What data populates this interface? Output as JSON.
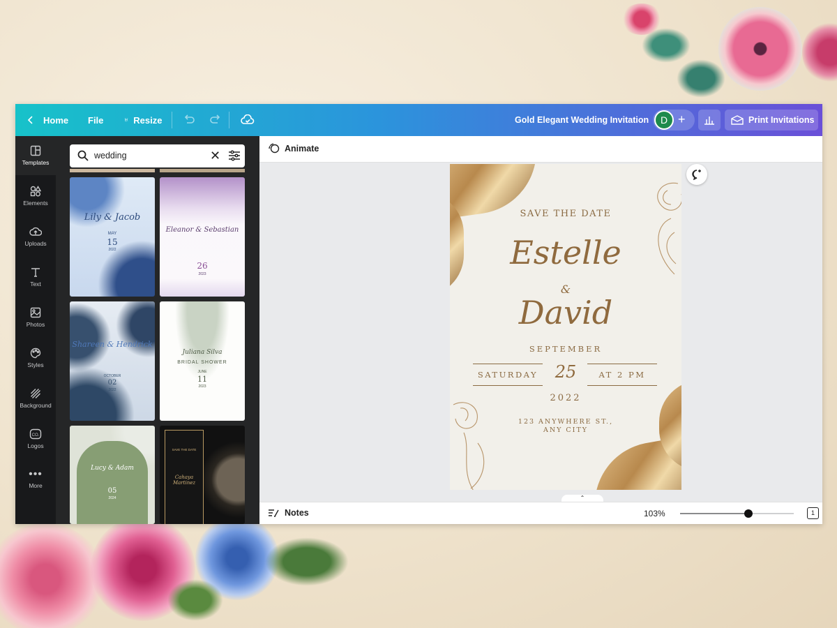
{
  "topbar": {
    "home": "Home",
    "file": "File",
    "resize": "Resize",
    "doc_title": "Gold Elegant Wedding Invitation",
    "avatar": "D",
    "print": "Print Invitations"
  },
  "rail": [
    {
      "label": "Templates",
      "icon": "template-icon"
    },
    {
      "label": "Elements",
      "icon": "shapes-icon"
    },
    {
      "label": "Uploads",
      "icon": "cloud-upload-icon"
    },
    {
      "label": "Text",
      "icon": "text-icon"
    },
    {
      "label": "Photos",
      "icon": "image-icon"
    },
    {
      "label": "Styles",
      "icon": "palette-icon"
    },
    {
      "label": "Background",
      "icon": "background-icon"
    },
    {
      "label": "Logos",
      "icon": "logo-icon"
    },
    {
      "label": "More",
      "icon": "more-icon"
    }
  ],
  "search": {
    "value": "wedding"
  },
  "templates": [
    {
      "title": "Lily & Jacob",
      "month": "MAY",
      "day": "15",
      "year": "2022",
      "theme": "blue watercolor"
    },
    {
      "title": "Eleanor & Sebastian",
      "day": "26",
      "year": "2023",
      "theme": "lavender wisteria"
    },
    {
      "title": "Shareen & Hendrick",
      "month": "OCTOBER",
      "day": "02",
      "year": "2022",
      "theme": "navy floral"
    },
    {
      "title": "Juliana Silva",
      "subtitle": "BRIDAL SHOWER",
      "month": "JUNE",
      "day": "11",
      "year": "2023",
      "theme": "white floral"
    },
    {
      "title": "Lucy & Adam",
      "day": "05",
      "year": "2024",
      "theme": "sage green"
    },
    {
      "title": "Cahaya Martinez",
      "subtitle": "SAVE THE DATE",
      "theme": "black gold"
    }
  ],
  "canvas": {
    "animate": "Animate",
    "notes": "Notes",
    "zoom": "103%",
    "zoom_fraction": 0.6,
    "page_count": "1"
  },
  "invitation": {
    "header": "SAVE THE DATE",
    "name1": "Estelle",
    "amp": "&",
    "name2": "David",
    "month": "SEPTEMBER",
    "weekday": "SATURDAY",
    "day": "25",
    "time": "AT 2 PM",
    "year": "2022",
    "address1": "123 ANYWHERE ST.,",
    "address2": "ANY CITY"
  },
  "colors": {
    "accent_start": "#17c2c9",
    "accent_end": "#6a4fd8",
    "gold": "#b8894d"
  }
}
